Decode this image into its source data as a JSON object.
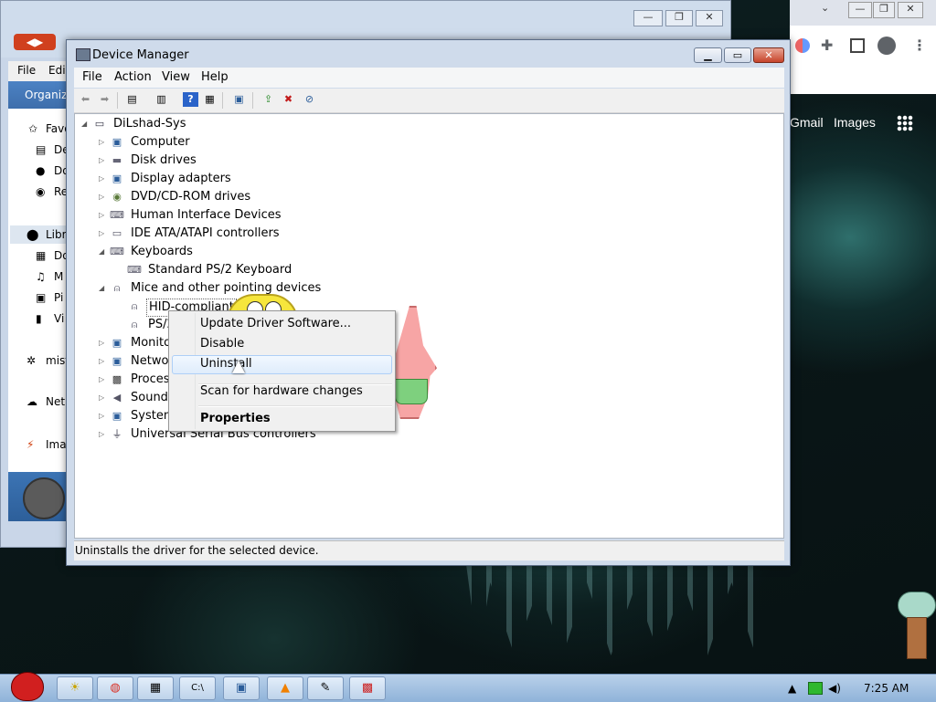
{
  "browser": {
    "controls": [
      "⌄",
      "—",
      "❐",
      "✕"
    ],
    "links": {
      "gmail": "Gmail",
      "images": "Images"
    }
  },
  "explorer": {
    "menu": [
      "File",
      "Edi"
    ],
    "toolbar_label": "Organiz",
    "nav": [
      {
        "label": "Favo"
      },
      {
        "label": "De"
      },
      {
        "label": "Do"
      },
      {
        "label": "Re"
      },
      {
        "label": "Libr"
      },
      {
        "label": "Do"
      },
      {
        "label": "M"
      },
      {
        "label": "Pi"
      },
      {
        "label": "Vi"
      },
      {
        "label": "mist"
      },
      {
        "label": "Net"
      },
      {
        "label": "Ima"
      }
    ]
  },
  "device_manager": {
    "title": "Device Manager",
    "menu": [
      "File",
      "Action",
      "View",
      "Help"
    ],
    "status": "Uninstalls the driver for the selected device.",
    "tree": {
      "root": "DiLshad-Sys",
      "items": [
        {
          "label": "Computer"
        },
        {
          "label": "Disk drives"
        },
        {
          "label": "Display adapters"
        },
        {
          "label": "DVD/CD-ROM drives"
        },
        {
          "label": "Human Interface Devices"
        },
        {
          "label": "IDE ATA/ATAPI controllers"
        },
        {
          "label": "Keyboards"
        },
        {
          "label": "Standard PS/2 Keyboard"
        },
        {
          "label": "Mice and other pointing devices"
        },
        {
          "label": "HID-compliant"
        },
        {
          "label": "PS/2"
        },
        {
          "label": "Monito"
        },
        {
          "label": "Networ"
        },
        {
          "label": "Proces"
        },
        {
          "label": "Sound,"
        },
        {
          "label": "System"
        },
        {
          "label": "Universal Serial Bus controllers"
        }
      ]
    },
    "context_menu": {
      "update": "Update Driver Software...",
      "disable": "Disable",
      "uninstall": "Uninstall",
      "scan": "Scan for hardware changes",
      "properties": "Properties"
    }
  },
  "taskbar": {
    "clock": "7:25 AM"
  }
}
